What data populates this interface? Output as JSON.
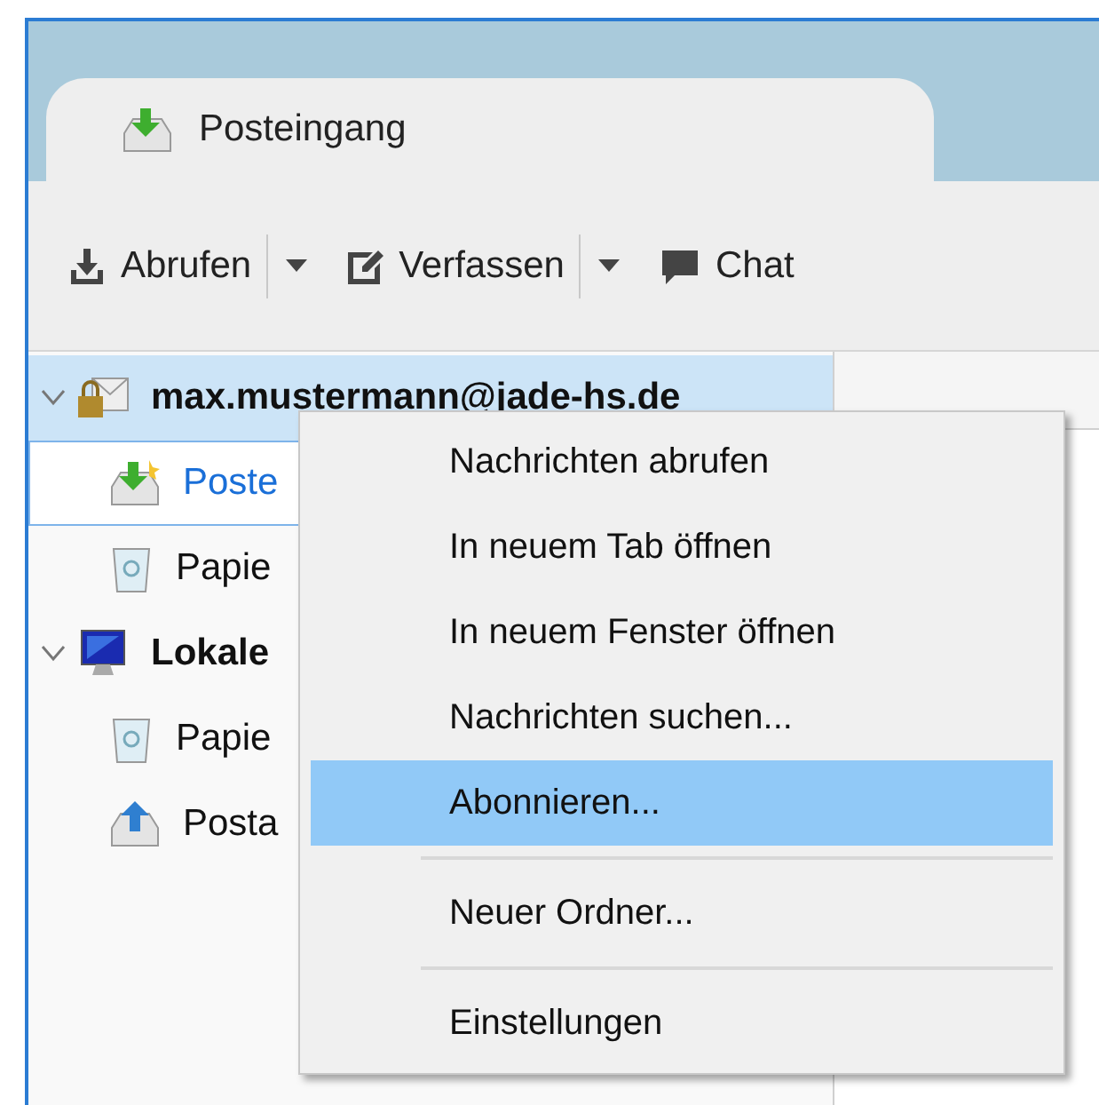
{
  "tabs": [
    {
      "label": "Posteingang",
      "selected": true
    }
  ],
  "toolbar": [
    {
      "kind": "fetch",
      "label": "Abrufen",
      "dropdown": true
    },
    {
      "kind": "compose",
      "label": "Verfassen",
      "dropdown": true
    },
    {
      "kind": "chat",
      "label": "Chat",
      "dropdown": false
    }
  ],
  "folders": [
    {
      "kind": "account",
      "label": "max.mustermann@jade-hs.de",
      "selected": false,
      "expanded": true,
      "children": [
        {
          "kind": "inbox",
          "label": "Poste",
          "selected": true
        },
        {
          "kind": "trash",
          "label": "Papie",
          "selected": false
        }
      ]
    },
    {
      "kind": "local",
      "label": "Lokale",
      "selected": false,
      "expanded": true,
      "children": [
        {
          "kind": "trash",
          "label": "Papie",
          "selected": false
        },
        {
          "kind": "outbox",
          "label": "Posta",
          "selected": false
        }
      ]
    }
  ],
  "context_menu": [
    {
      "label": "Nachrichten abrufen",
      "selected": false
    },
    {
      "label": "In neuem Tab öffnen",
      "selected": false
    },
    {
      "label": "In neuem Fenster öffnen",
      "selected": false
    },
    {
      "label": "Nachrichten suchen...",
      "selected": false
    },
    {
      "label": "Abonnieren...",
      "selected": true
    },
    {
      "kind": "separator"
    },
    {
      "label": "Neuer Ordner...",
      "selected": false
    },
    {
      "kind": "separator"
    },
    {
      "label": "Einstellungen",
      "selected": false
    }
  ]
}
